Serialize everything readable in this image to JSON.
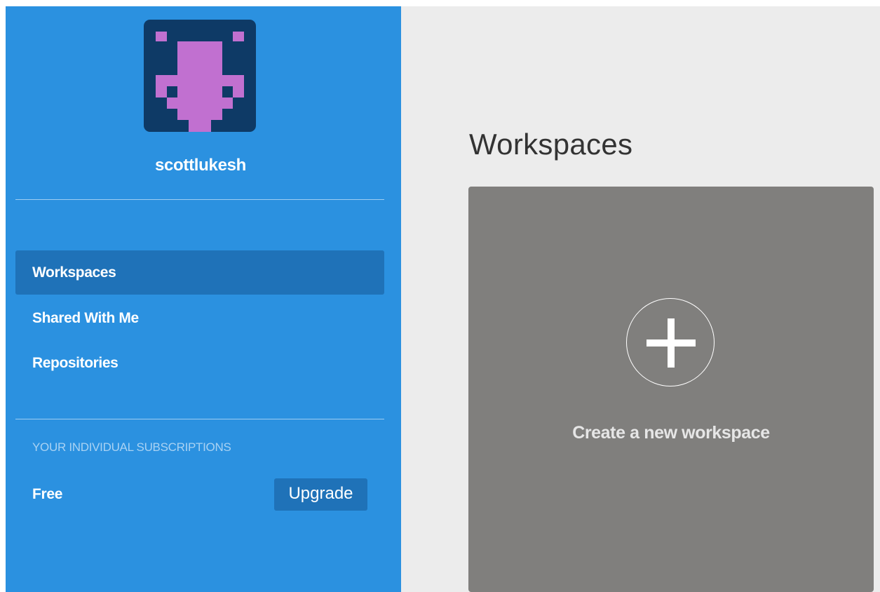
{
  "user": {
    "username": "scottlukesh",
    "avatar_icon": "pixel-identicon",
    "avatar_colors": {
      "background": "#0e3a66",
      "foreground": "#c170d0"
    }
  },
  "sidebar": {
    "nav": [
      {
        "label": "Workspaces",
        "active": true
      },
      {
        "label": "Shared With Me",
        "active": false
      },
      {
        "label": "Repositories",
        "active": false
      }
    ],
    "subscriptions": {
      "section_label": "YOUR INDIVIDUAL SUBSCRIPTIONS",
      "plan": "Free",
      "upgrade_label": "Upgrade"
    }
  },
  "main": {
    "title": "Workspaces",
    "create_card": {
      "icon": "plus-circle-icon",
      "label": "Create a new workspace"
    }
  },
  "colors": {
    "sidebar": "#2b91e0",
    "sidebar_active": "#1f72b8",
    "main_background": "#ececec",
    "card": "#807f7d"
  }
}
